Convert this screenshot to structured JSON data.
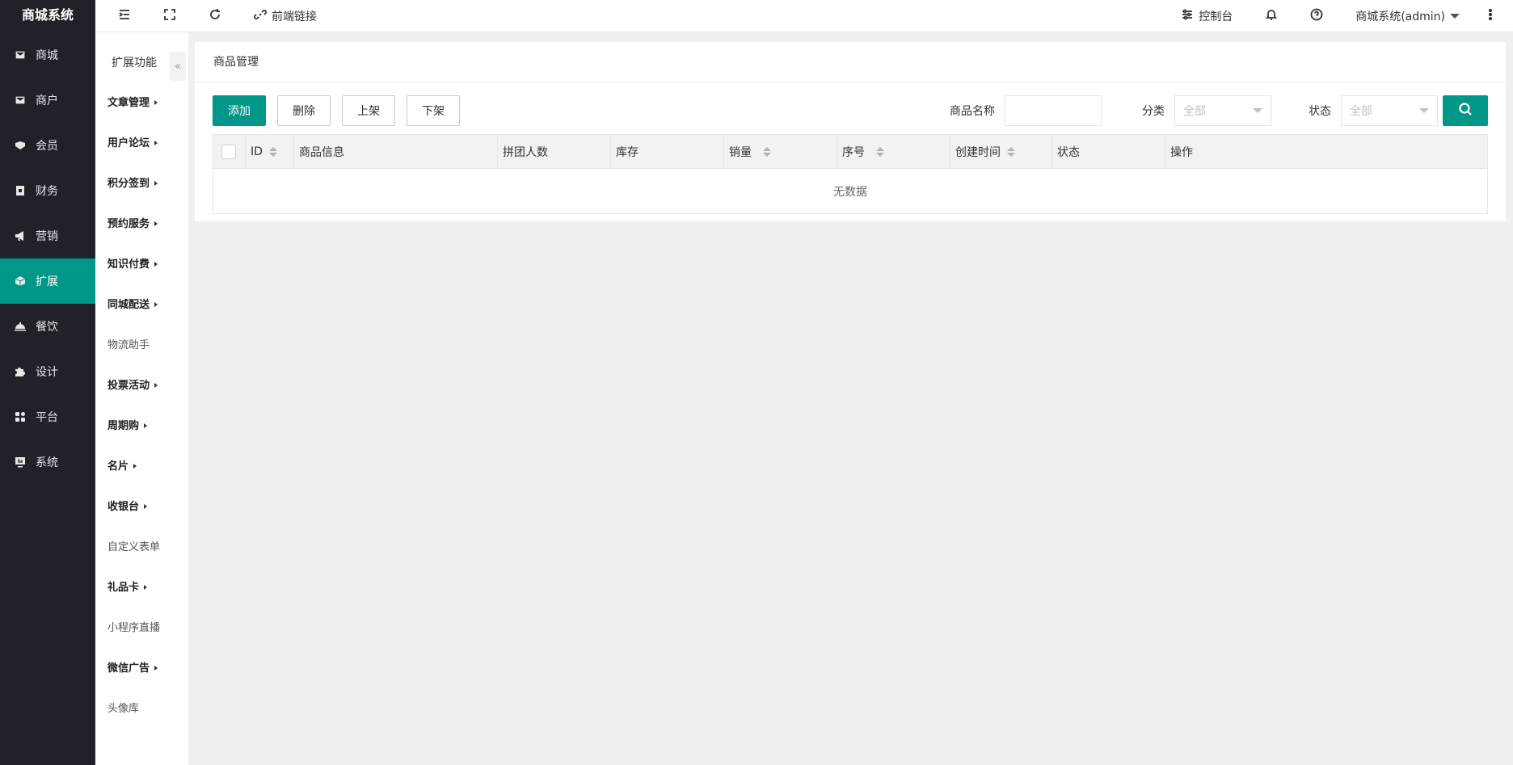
{
  "app": {
    "logo": "商城系统"
  },
  "sidebar": {
    "items": [
      {
        "label": "商城",
        "icon": "shop-icon"
      },
      {
        "label": "商户",
        "icon": "merchant-icon"
      },
      {
        "label": "会员",
        "icon": "member-icon"
      },
      {
        "label": "财务",
        "icon": "finance-icon"
      },
      {
        "label": "营销",
        "icon": "megaphone-icon"
      },
      {
        "label": "扩展",
        "icon": "cube-icon",
        "active": true
      },
      {
        "label": "餐饮",
        "icon": "dining-icon"
      },
      {
        "label": "设计",
        "icon": "puzzle-icon"
      },
      {
        "label": "平台",
        "icon": "grid-icon"
      },
      {
        "label": "系统",
        "icon": "monitor-icon"
      }
    ]
  },
  "header": {
    "frontend_link": "前端链接",
    "console": "控制台",
    "user": "商城系统(admin)"
  },
  "submenu": {
    "title": "扩展功能",
    "collapse": "«",
    "items": [
      {
        "label": "文章管理",
        "expandable": true
      },
      {
        "label": "用户论坛",
        "expandable": true
      },
      {
        "label": "积分签到",
        "expandable": true
      },
      {
        "label": "预约服务",
        "expandable": true
      },
      {
        "label": "知识付费",
        "expandable": true
      },
      {
        "label": "同城配送",
        "expandable": true
      },
      {
        "label": "物流助手",
        "expandable": false
      },
      {
        "label": "投票活动",
        "expandable": true
      },
      {
        "label": "周期购",
        "expandable": true
      },
      {
        "label": "名片",
        "expandable": true
      },
      {
        "label": "收银台",
        "expandable": true
      },
      {
        "label": "自定义表单",
        "expandable": false
      },
      {
        "label": "礼品卡",
        "expandable": true
      },
      {
        "label": "小程序直播",
        "expandable": false
      },
      {
        "label": "微信广告",
        "expandable": true
      },
      {
        "label": "头像库",
        "expandable": false
      }
    ]
  },
  "main": {
    "title": "商品管理",
    "buttons": {
      "add": "添加",
      "delete": "删除",
      "on_shelf": "上架",
      "off_shelf": "下架"
    },
    "filters": {
      "name_label": "商品名称",
      "name_value": "",
      "category_label": "分类",
      "category_value": "全部",
      "status_label": "状态",
      "status_value": "全部"
    },
    "table": {
      "columns": [
        "ID",
        "商品信息",
        "拼团人数",
        "库存",
        "销量",
        "序号",
        "创建时间",
        "状态",
        "操作"
      ],
      "empty_text": "无数据"
    }
  },
  "colors": {
    "accent": "#009688",
    "sidebar_bg": "#20222a"
  }
}
